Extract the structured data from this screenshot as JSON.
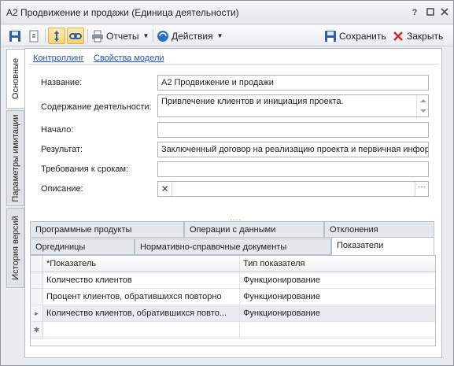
{
  "window": {
    "title": "А2 Продвижение и продажи (Единица деятельности)",
    "help_label": "?"
  },
  "toolbar": {
    "reports_label": "Отчеты",
    "actions_label": "Действия",
    "save_label": "Сохранить",
    "close_label": "Закрыть"
  },
  "side_tabs": [
    "Основные",
    "Параметры имитации",
    "История версий"
  ],
  "links": {
    "controlling": "Контроллинг",
    "model_properties": "Свойства модели"
  },
  "form": {
    "name_label": "Название:",
    "name_value": "А2 Продвижение и продажи",
    "content_label": "Содержание деятельности:",
    "content_value": "Привлечение клиентов и инициация проекта.",
    "start_label": "Начало:",
    "start_value": "",
    "result_label": "Результат:",
    "result_value": "Заключенный договор на реализацию проекта и первичная инфор",
    "deadline_label": "Требования к срокам:",
    "deadline_value": "",
    "description_label": "Описание:",
    "description_value": "",
    "lookup_clear": "✕",
    "lookup_dots": "···"
  },
  "splitter_glyph": "....",
  "tabs_row1": [
    "Программные продукты",
    "Операции с данными",
    "Отклонения"
  ],
  "tabs_row2": [
    "Оргединицы",
    "Нормативно-справочные документы",
    "Показатели"
  ],
  "grid": {
    "columns": [
      "*Показатель",
      "Тип показателя"
    ],
    "rows": [
      [
        "Количество клиентов",
        "Функционирование"
      ],
      [
        "Процент клиентов, обратившихся повторно",
        "Функционирование"
      ],
      [
        "Количество клиентов, обратившихся повто...",
        "Функционирование"
      ]
    ],
    "current_row_marker": "▸",
    "new_row_marker": "✱"
  },
  "colors": {
    "link": "#1a56b8",
    "window_bg": "#e8ebef",
    "accent_active": "#f9d56e"
  }
}
